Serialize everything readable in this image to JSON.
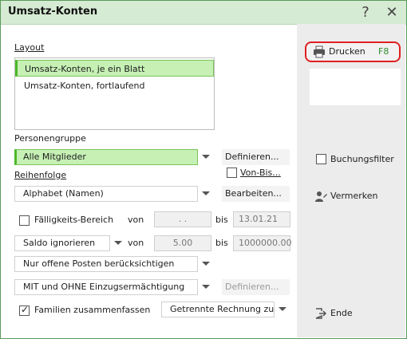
{
  "window": {
    "title": "Umsatz-Konten",
    "help_icon": "?",
    "close_icon": "✕"
  },
  "layout": {
    "label": "Layout",
    "items": [
      "Umsatz-Konten, je ein Blatt",
      "Umsatz-Konten, fortlaufend"
    ],
    "selected_index": 0
  },
  "personengruppe": {
    "label": "Personengruppe",
    "value": "Alle Mitglieder",
    "define_button": "Definieren...",
    "von_bis_label": "Von-Bis..."
  },
  "reihenfolge": {
    "label": "Reihenfolge",
    "value": "Alphabet (Namen)",
    "edit_button": "Bearbeiten..."
  },
  "faelligkeit": {
    "label": "Fälligkeits-Bereich",
    "checked": false,
    "von_label": "von",
    "von_value": ". .",
    "bis_label": "bis",
    "bis_value": "13.01.21"
  },
  "saldo": {
    "value": "Saldo ignorieren",
    "von_label": "von",
    "von_value": "5.00",
    "bis_label": "bis",
    "bis_value": "1000000.00"
  },
  "posten": {
    "value": "Nur offene Posten berücksichtigen"
  },
  "einzug": {
    "value": "MIT und OHNE Einzugsermächtigung",
    "define_button": "Definieren..."
  },
  "familien": {
    "label": "Familien zusammenfassen",
    "checked": true,
    "rechnung_value": "Getrennte Rechnung zusa"
  },
  "actions": {
    "print_label": "Drucken",
    "print_key": "F8",
    "buchungsfilter_label": "Buchungsfilter",
    "vermerken_label": "Vermerken",
    "ende_label": "Ende"
  },
  "icons": {
    "print": "printer-icon",
    "person": "person-pen-icon",
    "exit": "exit-icon"
  },
  "colors": {
    "titlebar": "#d6ebd3",
    "selection": "#c6f0b4",
    "selection_border": "#4cb82a",
    "highlight_ring": "#e02020",
    "panel": "#ececec"
  }
}
